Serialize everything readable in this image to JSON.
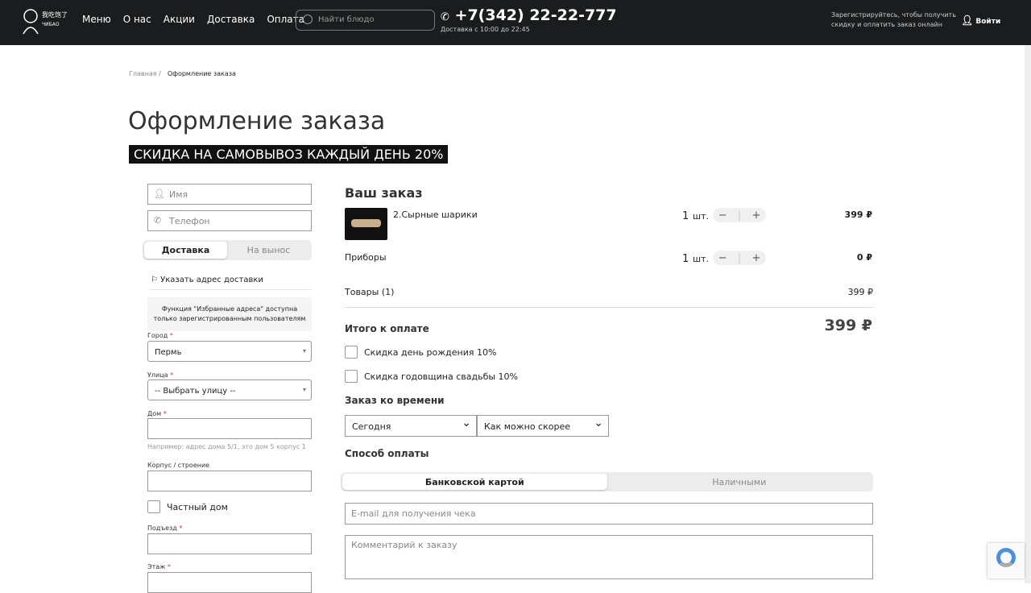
{
  "header": {
    "logo_text": "我吃饱了 ЧИБАО",
    "nav": [
      "Меню",
      "О нас",
      "Акции",
      "Доставка",
      "Оплата"
    ],
    "search_placeholder": "Найти блюдо",
    "phone": "+7(342) 22-22-777",
    "delivery_hours": "Доставка с 10:00 до 22:45",
    "register_line1": "Зарегистрируйтесь, чтобы получить",
    "register_line2": "скидку и оплатить заказ онлайн",
    "login": "Войти"
  },
  "breadcrumb": {
    "home": "Главная",
    "sep": "/",
    "current": "Оформление заказа"
  },
  "title": "Оформление заказа",
  "promo": "СКИДКА НА САМОВЫВОЗ КАЖДЫЙ ДЕНЬ 20%",
  "form": {
    "name_placeholder": "Имя",
    "phone_placeholder": "Телефон",
    "delivery_tabs": [
      "Доставка",
      "На вынос"
    ],
    "address_link": "Указать адрес доставки",
    "favorites_line1": "Функция \"Избранные адреса\" доступна",
    "favorites_line2": "только зарегистрированным пользователям",
    "city_label": "Город",
    "city_value": "Пермь",
    "street_label": "Улица",
    "street_value": "-- Выбрать улицу --",
    "house_label": "Дом",
    "house_hint": "Например: адрес дома 5/1, это дом 5 корпус 1",
    "building_label": "Корпус / строение",
    "private_house": "Частный дом",
    "entrance_label": "Подъезд",
    "floor_label": "Этаж",
    "required": "*"
  },
  "order": {
    "title": "Ваш заказ",
    "items": [
      {
        "name": "2.Сырные шарики",
        "qty": "1",
        "unit": "шт.",
        "price": "399 ₽"
      },
      {
        "name": "Приборы",
        "qty": "1",
        "unit": "шт.",
        "price": "0 ₽"
      }
    ],
    "goods_label": "Товары (1)",
    "goods_sum": "399 ₽",
    "total_label": "Итого к оплате",
    "total": "399 ₽",
    "discounts": [
      "Скидка день рождения 10%",
      "Скидка годовщина свадьбы 10%"
    ],
    "time_title": "Заказ ко времени",
    "day": "Сегодня",
    "time": "Как можно скорее",
    "payment_title": "Способ оплаты",
    "payment_tabs": [
      "Банковской картой",
      "Наличными"
    ],
    "email_placeholder": "E-mail для получения чека",
    "comment_placeholder": "Комментарий к заказу"
  }
}
